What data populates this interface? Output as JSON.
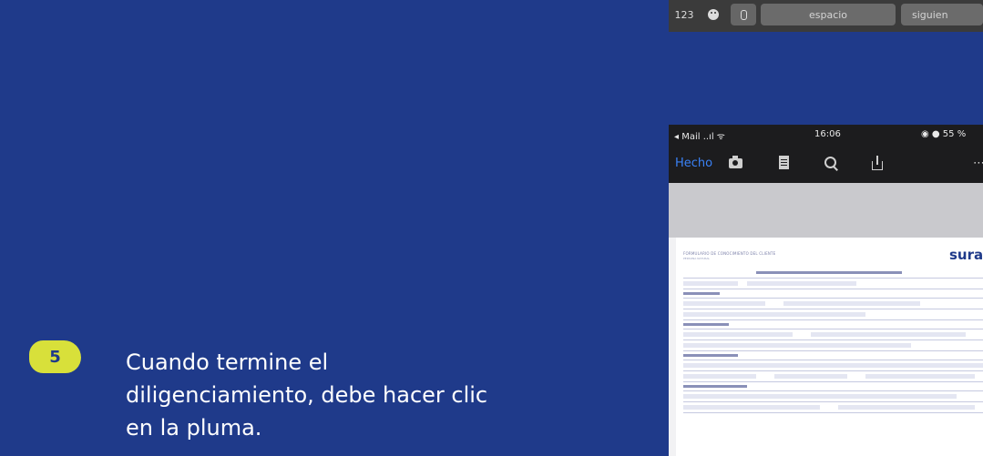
{
  "keyboard": {
    "key_numbers": "123",
    "key_space": "espacio",
    "key_next": "siguien"
  },
  "phone": {
    "status_left": "◂ Mail ..ıl ᯤ",
    "status_time": "16:06",
    "status_right": "◉ ● 55 %",
    "done_label": "Hecho",
    "more_label": "⋯",
    "document": {
      "title": "FORMULARIO DE CONOCIMIENTO DEL CLIENTE",
      "subtitle": "PERSONA NATURAL",
      "brand": "sura"
    }
  },
  "instructions": {
    "step_number": "5",
    "text": "Cuando termine el diligenciamiento, debe hacer clic en la pluma."
  },
  "colors": {
    "background": "#1f3a8a",
    "badge": "#d8e03a",
    "text": "#ffffff"
  }
}
